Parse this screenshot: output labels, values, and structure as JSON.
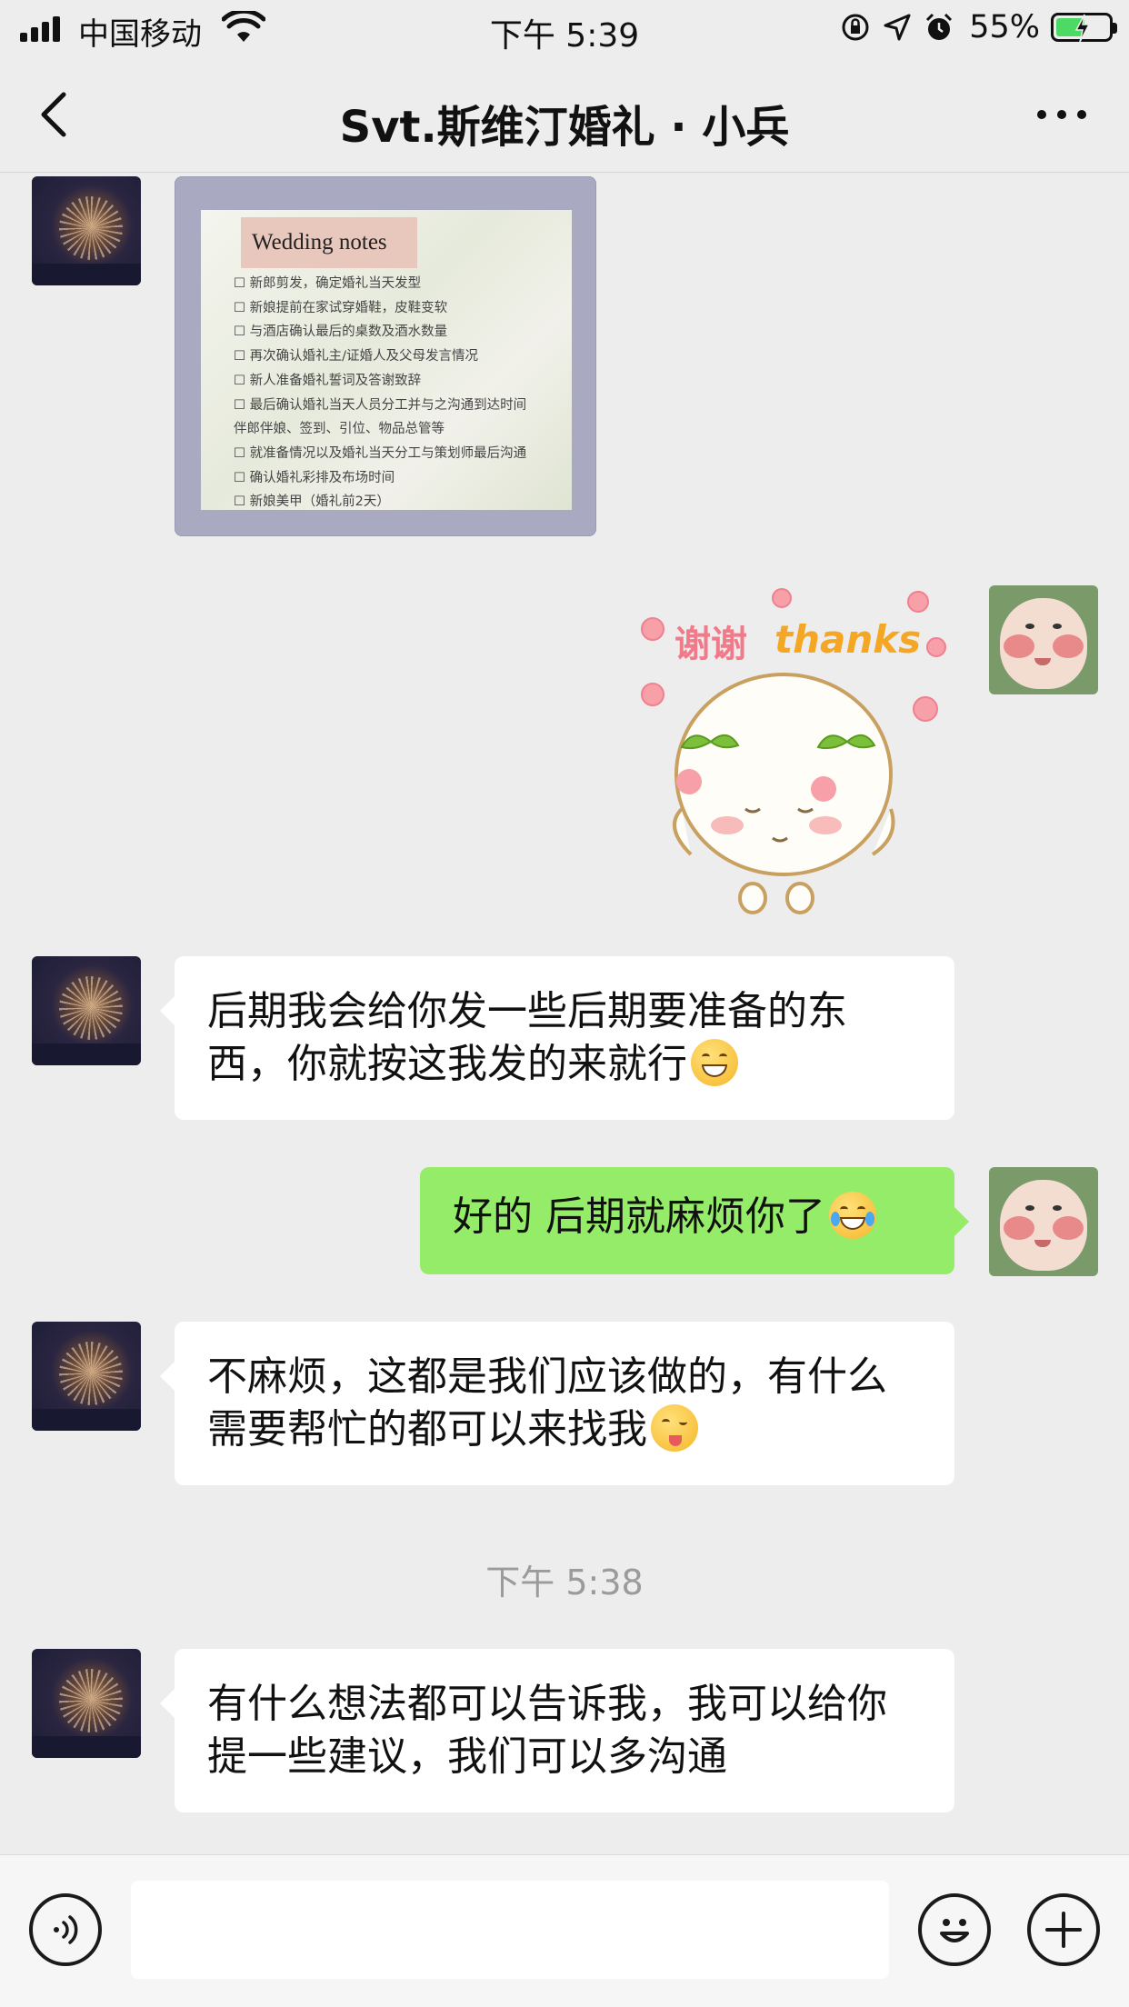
{
  "status_bar": {
    "carrier": "中国移动",
    "time": "下午 5:39",
    "battery_percent": "55%",
    "battery_level": 0.55,
    "signal_bars": 4,
    "icons": [
      "signal-icon",
      "wifi-icon",
      "orientation-lock-icon",
      "location-icon",
      "alarm-icon",
      "battery-charging-icon"
    ]
  },
  "nav": {
    "title": "Svt.斯维汀婚礼 · 小兵",
    "back_icon": "chevron-left-icon",
    "more_icon": "more-dots-icon"
  },
  "messages": {
    "image_note": {
      "tag": "Wedding notes",
      "items": [
        "☐ 新郎剪发，确定婚礼当天发型",
        "☐ 新娘提前在家试穿婚鞋，皮鞋变软",
        "☐ 与酒店确认最后的桌数及酒水数量",
        "☐ 再次确认婚礼主/证婚人及父母发言情况",
        "☐ 新人准备婚礼誓词及答谢致辞",
        "☐ 最后确认婚礼当天人员分工并与之沟通到达时间",
        "伴郎伴娘、签到、引位、物品总管等",
        "☐ 就准备情况以及婚礼当天分工与策划师最后沟通",
        "☐ 确认婚礼彩排及布场时间",
        "☐ 新娘美甲（婚礼前2天）"
      ]
    },
    "sticker": {
      "text_cn": "谢谢",
      "text_en": "thanks"
    },
    "msg1": "后期我会给你发一些后期要准备的东西，你就按这我发的来就行",
    "msg2": "好的 后期就麻烦你了",
    "msg3": "不麻烦，这都是我们应该做的，有什么需要帮忙的都可以来找我",
    "timestamp": "下午 5:38",
    "msg4": "有什么想法都可以告诉我，我可以给你提一些建议，我们可以多沟通"
  },
  "input_bar": {
    "text": "",
    "icons": [
      "voice-icon",
      "emoji-icon",
      "plus-icon"
    ]
  },
  "colors": {
    "background": "#ededed",
    "bubble_received": "#ffffff",
    "bubble_sent": "#95ec69",
    "timestamp": "#9b9b9b",
    "battery_fill": "#4cd964"
  }
}
